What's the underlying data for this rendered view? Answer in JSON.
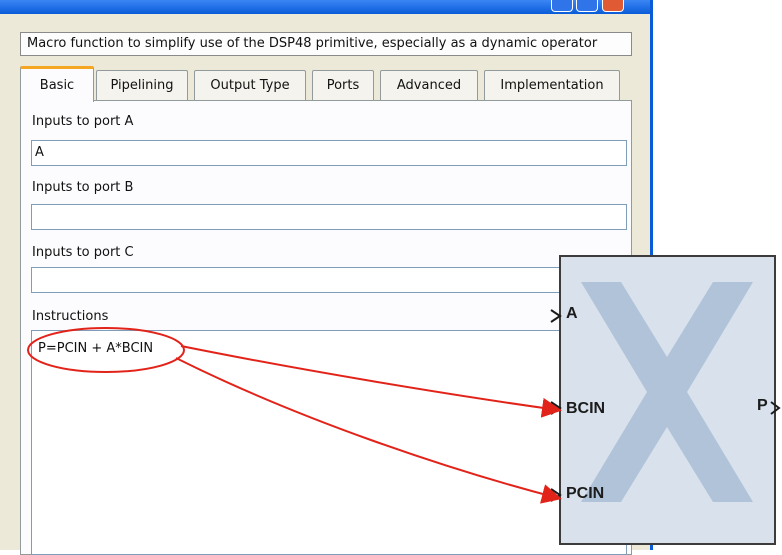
{
  "window": {
    "description": "Macro function to simplify use of the DSP48 primitive, especially as a dynamic operator",
    "tabs": [
      {
        "label": "Basic"
      },
      {
        "label": "Pipelining"
      },
      {
        "label": "Output Type"
      },
      {
        "label": "Ports"
      },
      {
        "label": "Advanced"
      },
      {
        "label": "Implementation"
      }
    ],
    "active_tab": "Basic"
  },
  "basic": {
    "port_a_label": "Inputs to port A",
    "port_a_value": "A",
    "port_b_label": "Inputs to port B",
    "port_b_value": "",
    "port_c_label": "Inputs to port C",
    "port_c_value": "",
    "instructions_label": "Instructions",
    "instructions_value": "P=PCIN + A*BCIN"
  },
  "block": {
    "port_a": "A",
    "port_bcin": "BCIN",
    "port_pcin": "PCIN",
    "port_p": "P"
  },
  "colors": {
    "annotation": "#e2231a",
    "block_fill": "#d8e1ec",
    "logo": "#a9bdd6",
    "titlebar": "#0a5bd8",
    "active_tab_accent": "#f5a623"
  }
}
